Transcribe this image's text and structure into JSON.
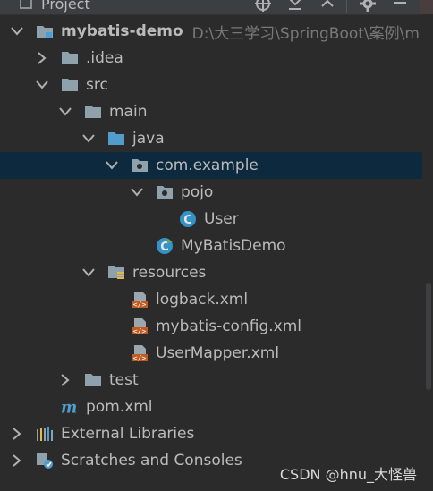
{
  "toolbar": {
    "title": "Project"
  },
  "tree": {
    "root": {
      "label": "mybatis-demo",
      "path": "D:\\大三学习\\SpringBoot\\案例\\m"
    },
    "idea": "idea",
    "idea_prefix": ".",
    "src": "src",
    "main": "main",
    "java": "java",
    "package": "com.example",
    "pojo": "pojo",
    "user_class": "User",
    "app_class": "MyBatisDemo",
    "resources": "resources",
    "logback": "logback.xml",
    "mybatis_config": "mybatis-config.xml",
    "user_mapper": "UserMapper.xml",
    "test": "test",
    "pom": "pom.xml",
    "external_libs": "External Libraries",
    "scratches": "Scratches and Consoles"
  },
  "watermark": "CSDN @hnu_大怪兽",
  "colors": {
    "background": "#2b2b2b",
    "selection": "#0d293e",
    "folder": "#8fa1ad",
    "source_folder": "#4f9ccd",
    "xml_icon": "#c05a20",
    "class_icon": "#3592c4"
  }
}
